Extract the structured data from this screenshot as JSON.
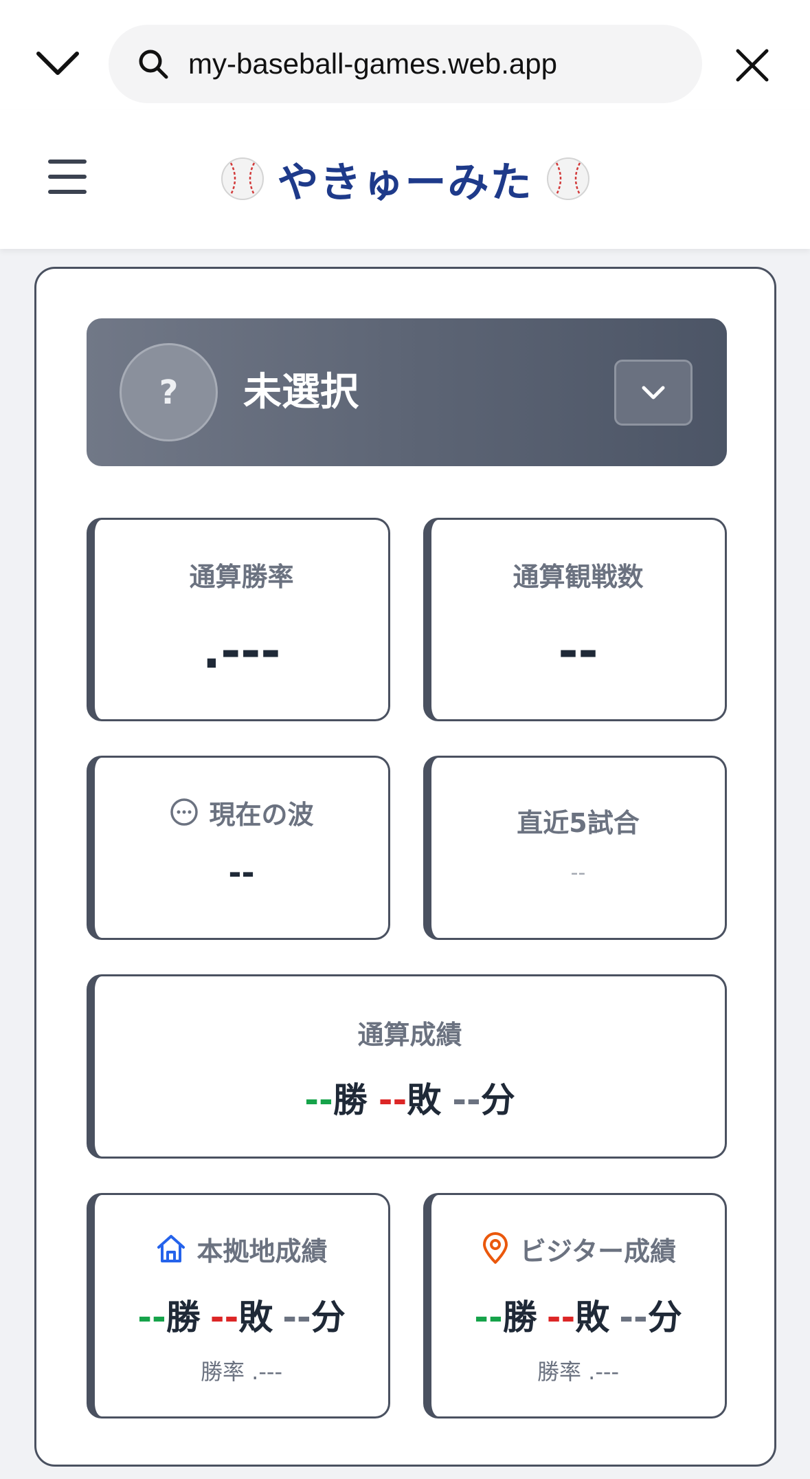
{
  "browser": {
    "url": "my-baseball-games.web.app"
  },
  "header": {
    "title": "やきゅーみた"
  },
  "team": {
    "avatar_text": "?",
    "name": "未選択"
  },
  "stats": {
    "win_rate": {
      "label": "通算勝率",
      "value": ".---"
    },
    "games_watched": {
      "label": "通算観戦数",
      "value": "--"
    },
    "current_streak": {
      "label": "現在の波",
      "value": "--"
    },
    "last5": {
      "label": "直近5試合",
      "value": "--"
    }
  },
  "overall_record": {
    "label": "通算成績",
    "wins": "--",
    "wins_unit": "勝",
    "losses": "--",
    "losses_unit": "敗",
    "draws": "--",
    "draws_unit": "分"
  },
  "home_record": {
    "label": "本拠地成績",
    "wins": "--",
    "wins_unit": "勝",
    "losses": "--",
    "losses_unit": "敗",
    "draws": "--",
    "draws_unit": "分",
    "rate_text": "勝率 .---"
  },
  "visitor_record": {
    "label": "ビジター成績",
    "wins": "--",
    "wins_unit": "勝",
    "losses": "--",
    "losses_unit": "敗",
    "draws": "--",
    "draws_unit": "分",
    "rate_text": "勝率 .---"
  },
  "colors": {
    "brand": "#1e3a8a",
    "win": "#16a34a",
    "lose": "#dc2626",
    "draw": "#6b7280",
    "home_icon": "#2563eb",
    "visitor_icon": "#ea580c"
  },
  "icons": {
    "collapse": "chevron-down-icon",
    "search": "search-icon",
    "close": "close-icon",
    "menu": "hamburger-icon",
    "ball": "baseball-icon",
    "dropdown": "chevron-down-icon",
    "streak": "ellipsis-circle-icon",
    "home": "home-icon",
    "visitor": "map-pin-icon"
  }
}
